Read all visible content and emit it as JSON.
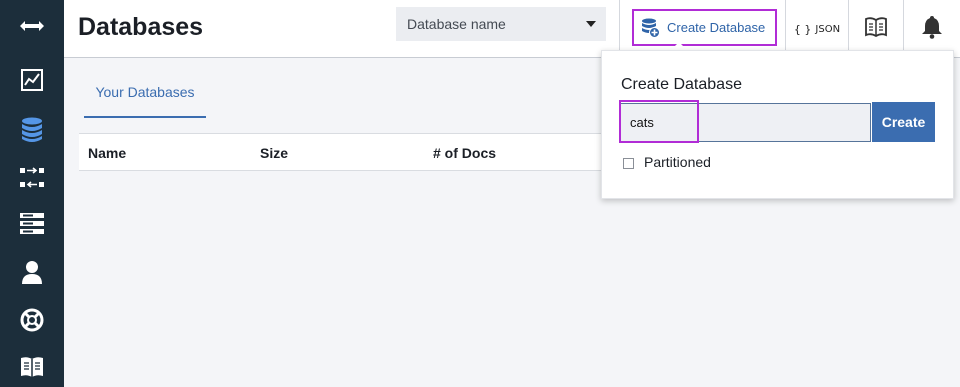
{
  "sidebar": {
    "items": [
      {
        "icon": "expand-arrows-icon"
      },
      {
        "icon": "activity-chart-icon"
      },
      {
        "icon": "database-icon",
        "active": true
      },
      {
        "icon": "replication-icon"
      },
      {
        "icon": "server-icon"
      },
      {
        "icon": "user-icon"
      },
      {
        "icon": "support-lifebuoy-icon"
      },
      {
        "icon": "documentation-book-icon"
      }
    ],
    "active_color": "#5596e6",
    "background": "#1c2e3b"
  },
  "header": {
    "title": "Databases",
    "db_select": {
      "placeholder": "Database name"
    },
    "create_db_label": "Create Database",
    "json_label": "JSON",
    "json_brackets": "{ }"
  },
  "tabs": [
    {
      "label": "Your Databases",
      "active": true
    }
  ],
  "table": {
    "columns": [
      "Name",
      "Size",
      "# of Docs"
    ]
  },
  "create_panel": {
    "title": "Create Database",
    "input_value": "cats",
    "create_label": "Create",
    "partitioned_label": "Partitioned",
    "partitioned_checked": false
  },
  "colors": {
    "accent": "#3b6db0",
    "highlight": "#b12cd6"
  }
}
